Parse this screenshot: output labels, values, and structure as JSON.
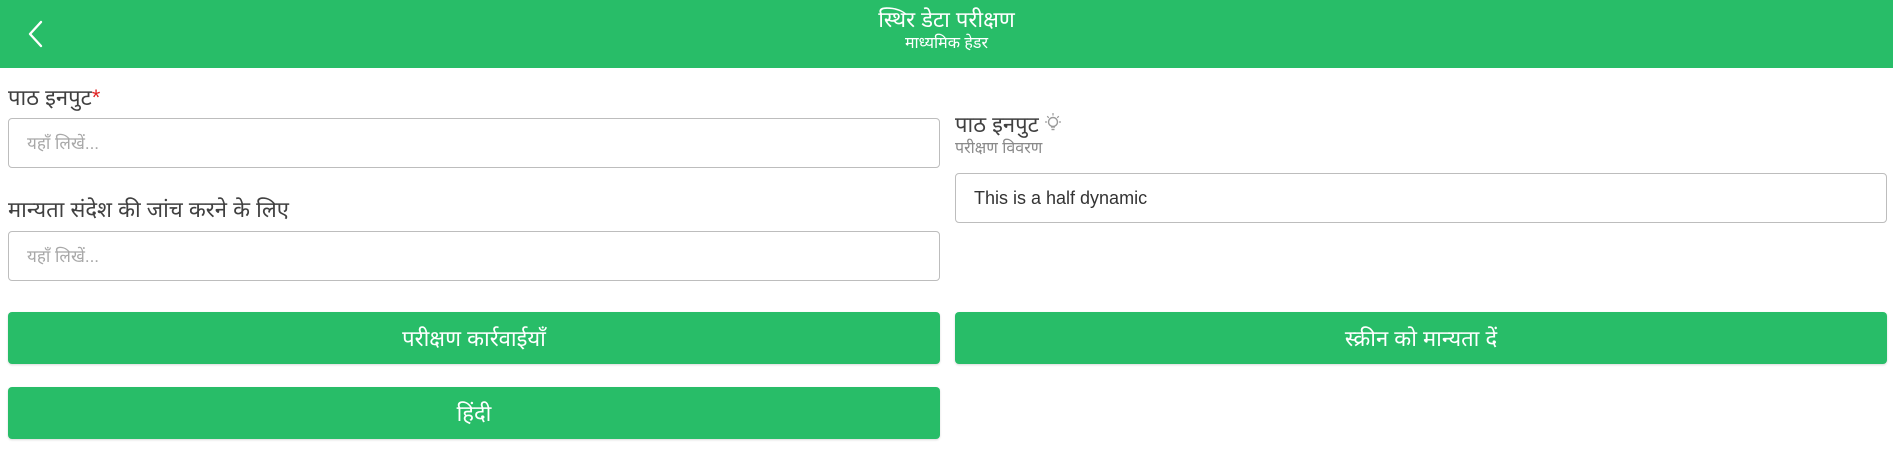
{
  "header": {
    "title": "स्थिर डेटा परीक्षण",
    "subtitle": "माध्यमिक हेडर",
    "back_icon": "chevron-left-icon",
    "background_color": "#28bd68"
  },
  "form": {
    "text_input_1": {
      "label": "पाठ इनपुट",
      "required_marker": "*",
      "placeholder": "यहाँ लिखें...",
      "value": ""
    },
    "validation_input": {
      "label": "मान्यता संदेश की जांच करने के लिए",
      "placeholder": "यहाँ लिखें...",
      "value": ""
    },
    "text_input_2": {
      "label": "पाठ इनपुट",
      "hint_icon": "lightbulb-icon",
      "description": "परीक्षण विवरण",
      "value": "This is a half dynamic"
    }
  },
  "buttons": {
    "test_actions": "परीक्षण कार्रवाईयाँ",
    "validate_screen": "स्क्रीन को मान्यता दें",
    "hindi": "हिंदी"
  },
  "colors": {
    "accent": "#28bd68",
    "required": "#e02020"
  }
}
